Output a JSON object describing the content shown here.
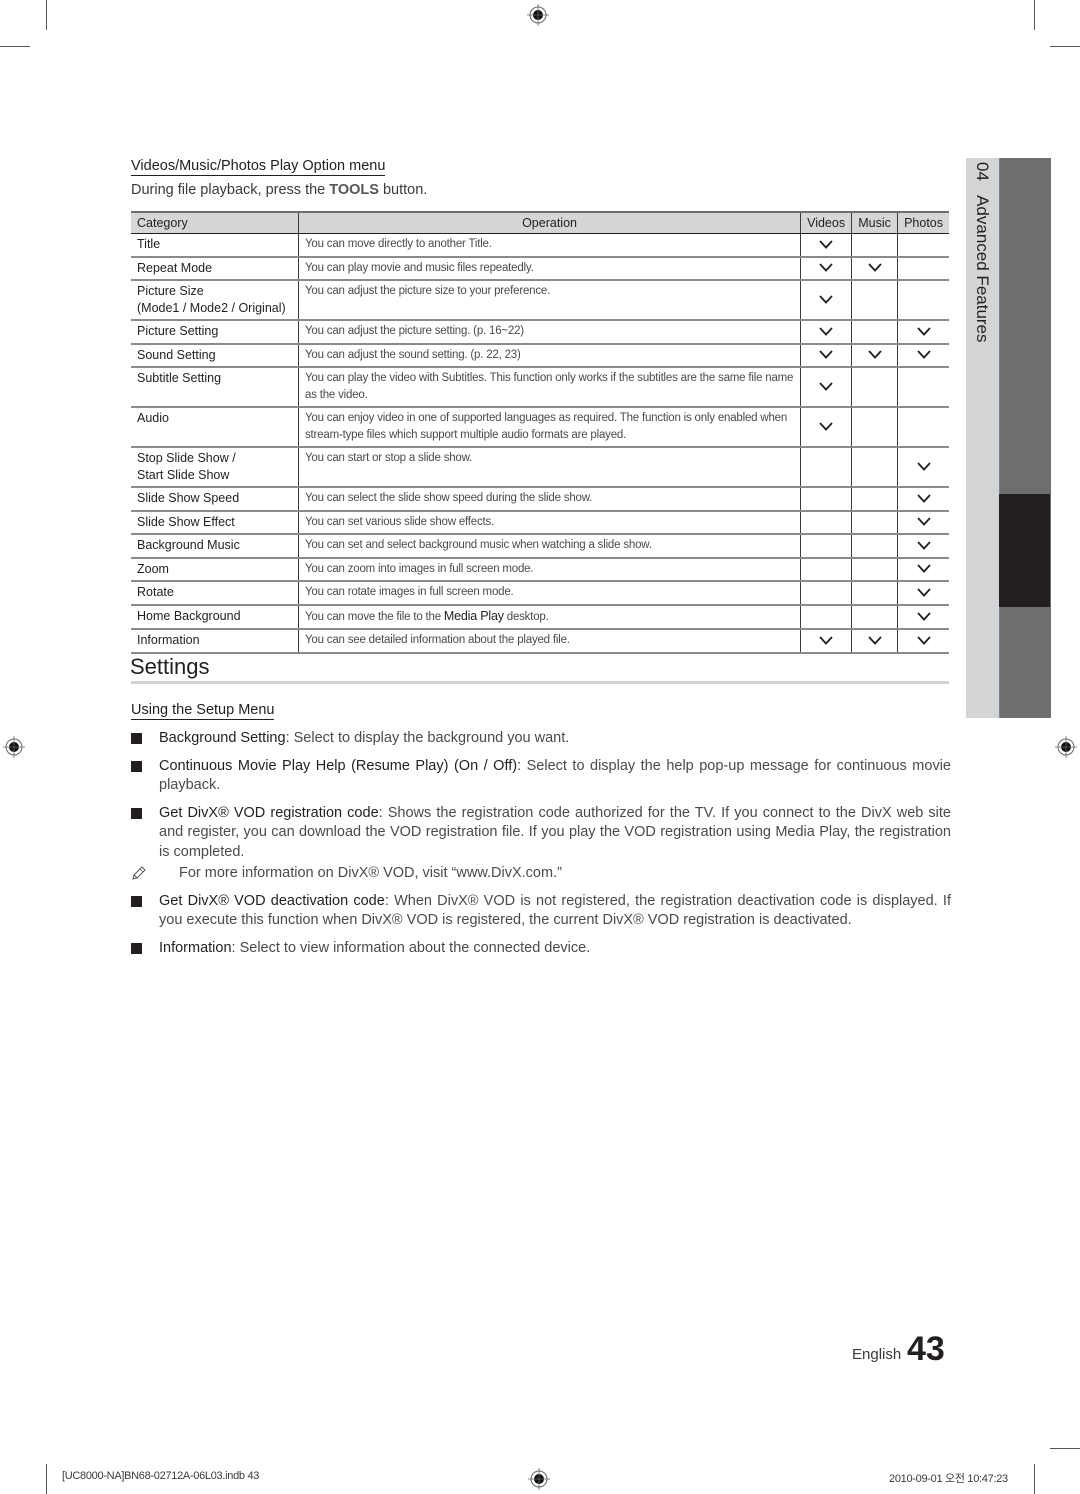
{
  "section": {
    "sub_heading": "Videos/Music/Photos Play Option menu",
    "intro_prefix": "During file playback, press the ",
    "intro_key": "TOOLS",
    "intro_suffix": " button."
  },
  "table": {
    "headers": {
      "category": "Category",
      "operation": "Operation",
      "videos": "Videos",
      "music": "Music",
      "photos": "Photos"
    },
    "check_icon": "check-chevron-icon",
    "rows": [
      {
        "category": "Title",
        "operation": "You can move directly to another Title.",
        "videos": true,
        "music": false,
        "photos": false
      },
      {
        "category": "Repeat Mode",
        "operation": "You can play movie and music files repeatedly.",
        "videos": true,
        "music": true,
        "photos": false
      },
      {
        "category": "Picture Size\n(Mode1 / Mode2 / Original)",
        "operation": "You can adjust the picture size to your preference.",
        "videos": true,
        "music": false,
        "photos": false
      },
      {
        "category": "Picture Setting",
        "operation": "You can adjust the picture setting. (p. 16~22)",
        "videos": true,
        "music": false,
        "photos": true
      },
      {
        "category": "Sound Setting",
        "operation": "You can adjust the sound setting. (p. 22, 23)",
        "videos": true,
        "music": true,
        "photos": true
      },
      {
        "category": "Subtitle Setting",
        "operation": "You can play the video with Subtitles. This function only works if the subtitles are the same file name as the video.",
        "videos": true,
        "music": false,
        "photos": false
      },
      {
        "category": "Audio",
        "operation": "You can enjoy video in one of supported languages as required. The function is only enabled when stream-type files which support multiple audio formats are played.",
        "videos": true,
        "music": false,
        "photos": false
      },
      {
        "category": "Stop Slide Show /\nStart Slide Show",
        "operation": "You can start or stop a slide show.",
        "videos": false,
        "music": false,
        "photos": true
      },
      {
        "category": "Slide Show Speed",
        "operation": "You can select the slide show speed during the slide show.",
        "videos": false,
        "music": false,
        "photos": true
      },
      {
        "category": "Slide Show Effect",
        "operation": "You can set various slide show effects.",
        "videos": false,
        "music": false,
        "photos": true
      },
      {
        "category": "Background Music",
        "operation": "You can set and select background music when watching a slide show.",
        "videos": false,
        "music": false,
        "photos": true
      },
      {
        "category": "Zoom",
        "operation": "You can zoom into images in full screen mode.",
        "videos": false,
        "music": false,
        "photos": true
      },
      {
        "category": "Rotate",
        "operation": "You can rotate images in full screen mode.",
        "videos": false,
        "music": false,
        "photos": true
      },
      {
        "category": "Home Background",
        "operation": "You can move the file to the ",
        "operation_bold": "Media Play",
        "operation_suffix": " desktop.",
        "videos": false,
        "music": false,
        "photos": true
      },
      {
        "category": "Information",
        "operation": "You can see detailed information about the played file.",
        "videos": true,
        "music": true,
        "photos": true
      }
    ]
  },
  "settings": {
    "title": "Settings",
    "setup_heading": "Using the Setup Menu",
    "items": [
      {
        "lead": "Background Setting",
        "text": ": Select to display the background you want."
      },
      {
        "lead": "Continuous Movie Play Help (Resume Play) (On / Off)",
        "text": ": Select to display the help pop-up message for continuous movie playback."
      },
      {
        "lead": "Get DivX® VOD registration code",
        "text": ": Shows the registration code authorized for the TV. If you connect to the DivX web site and register, you can download the VOD registration file. If you play the VOD registration using Media Play, the registration is completed."
      },
      {
        "lead": "Get DivX® VOD deactivation code",
        "text": ": When DivX® VOD is not registered, the registration deactivation code is displayed. If you execute this function when DivX® VOD is registered, the current DivX® VOD registration is deactivated."
      },
      {
        "lead": "Information",
        "text": ": Select to view information about the connected device."
      }
    ],
    "note": "For more information on DivX® VOD, visit “www.DivX.com.”"
  },
  "side_tab": {
    "chapter": "04",
    "label": "Advanced Features"
  },
  "footer": {
    "language": "English",
    "page_number": "43",
    "slug_left": "[UC8000-NA]BN68-02712A-06L03.indb   43",
    "slug_right": "2010-09-01   오전 10:47:23"
  }
}
